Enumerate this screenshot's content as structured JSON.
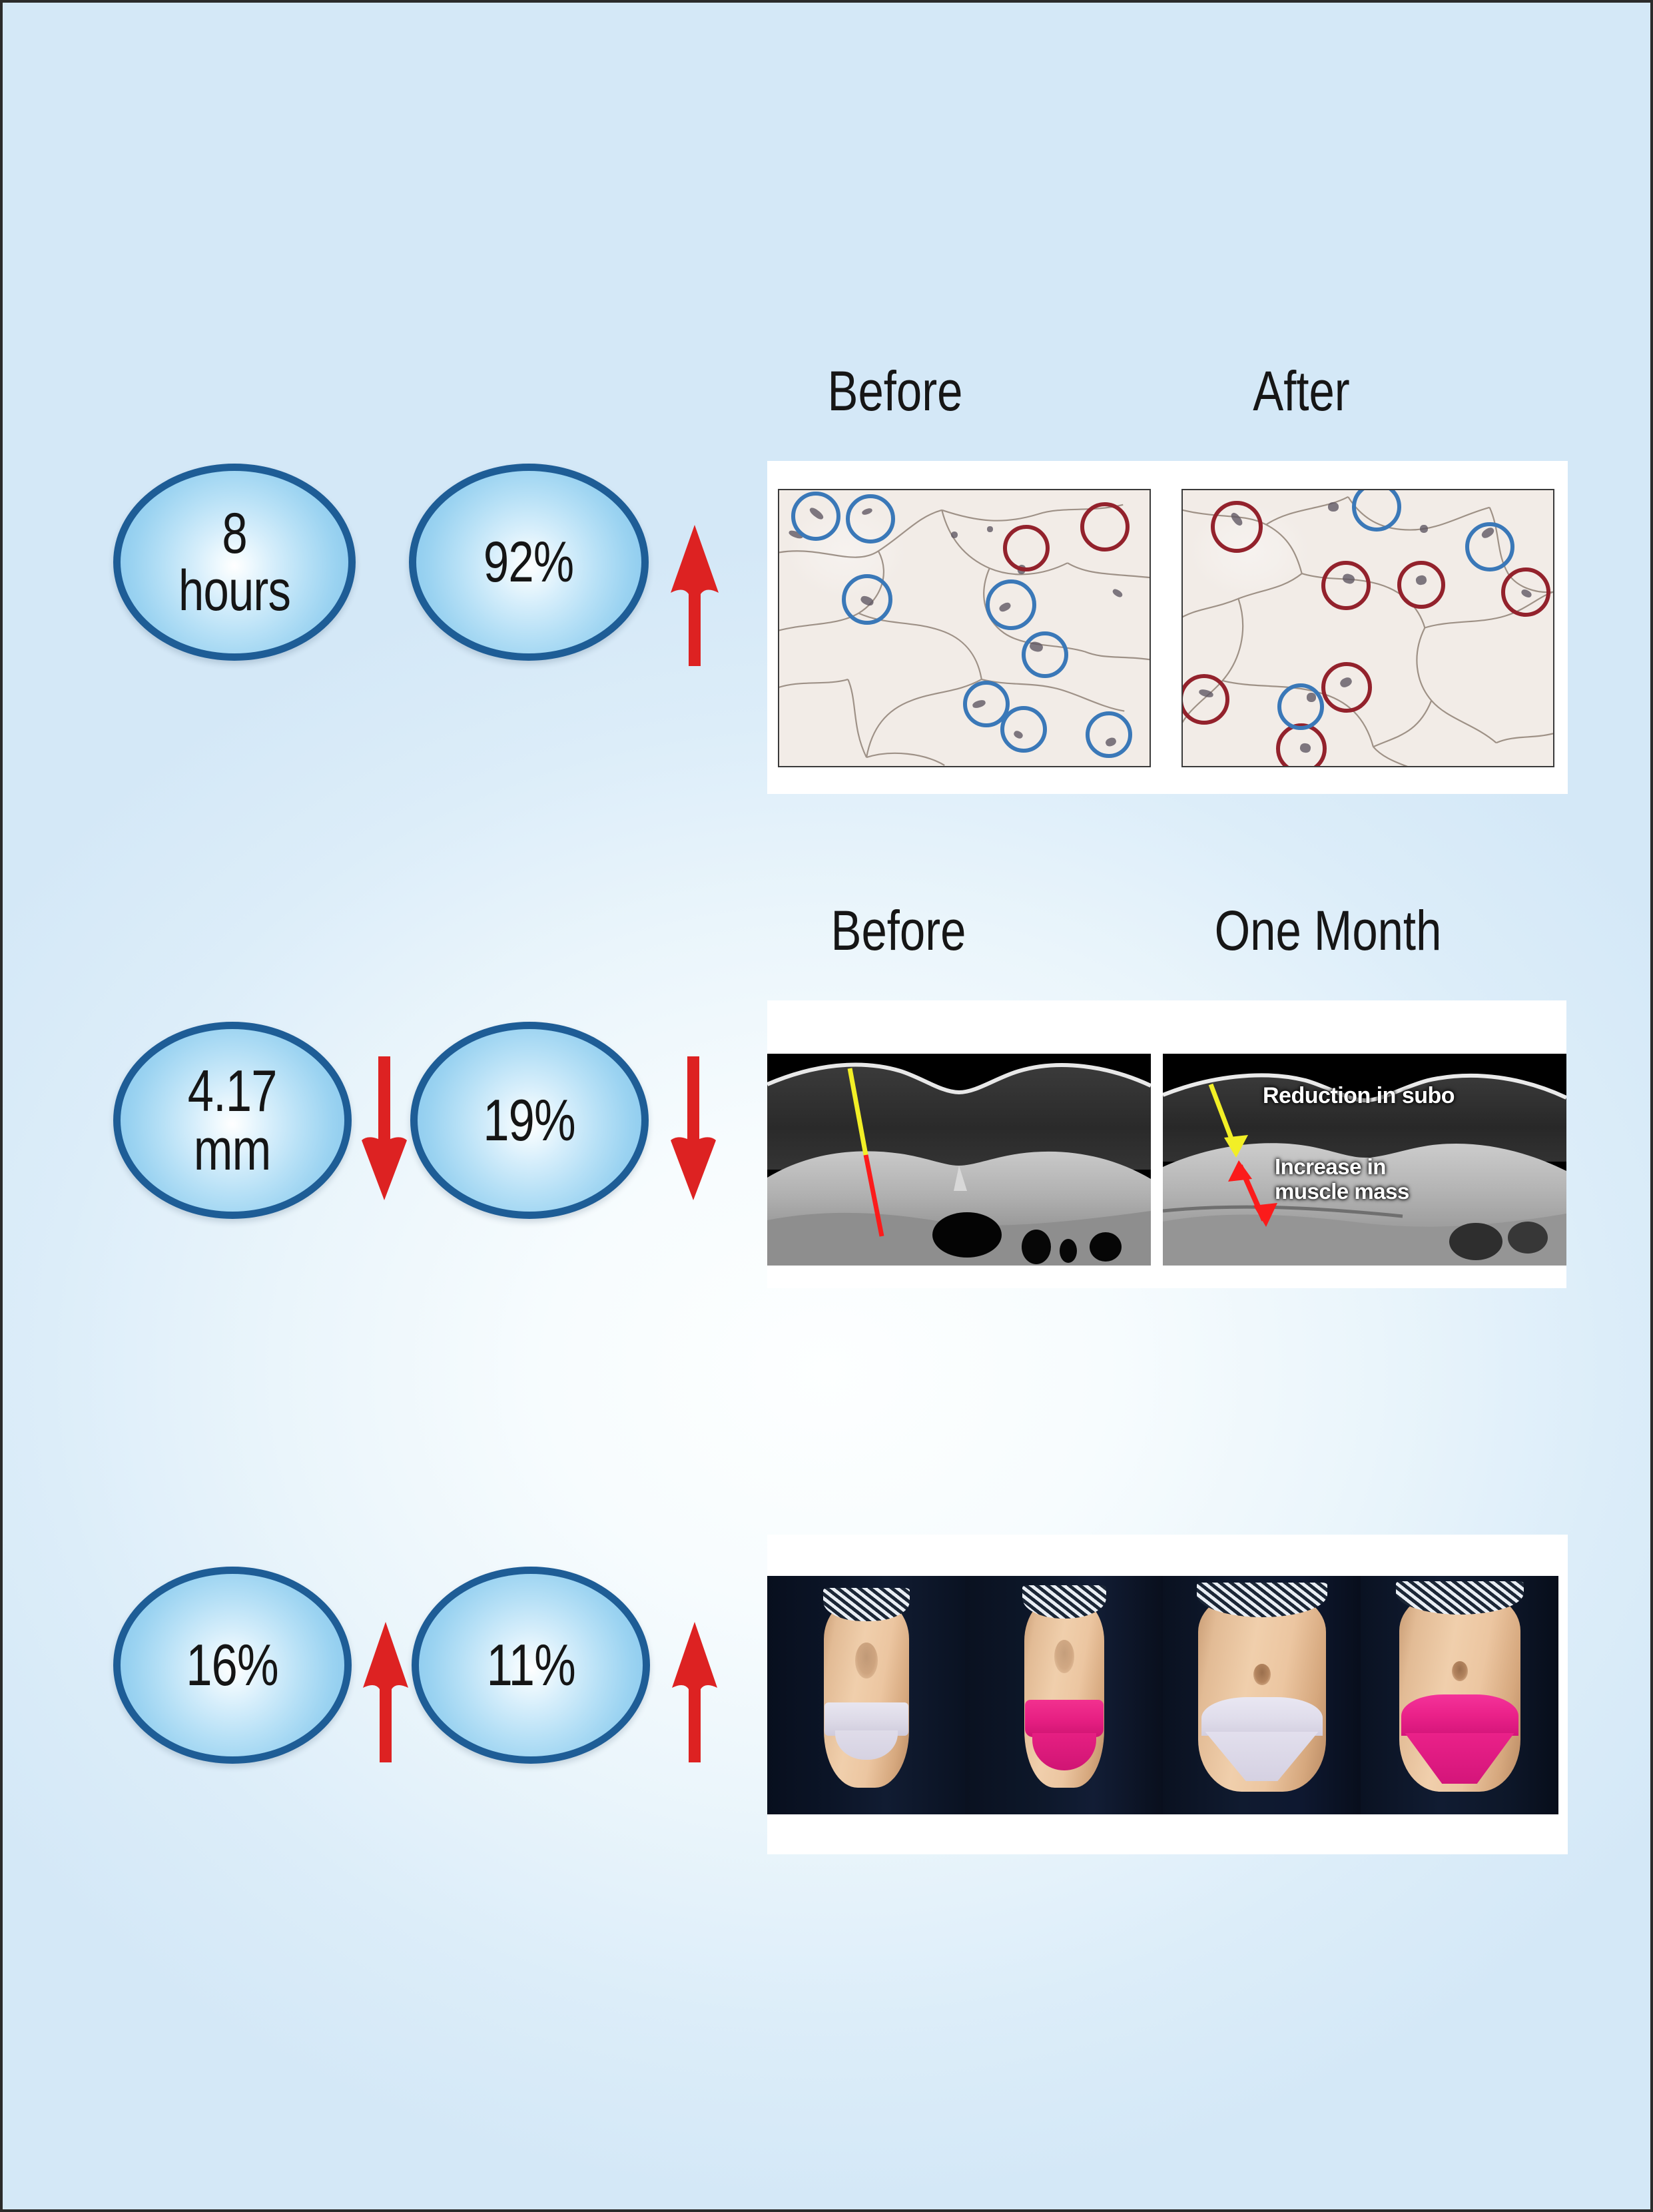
{
  "page": {
    "background_edge_color": "#d6eaf8",
    "background_center_color": "#fdffff",
    "border_color": "#2b2b2b"
  },
  "theme": {
    "circle_border": "#1e5d96",
    "circle_fill_edge": "#84c6ec",
    "circle_fill_center": "#ffffff",
    "arrow_red": "#dd2222",
    "panel_white": "#ffffff",
    "histology_blue_marker": "#3a78b8",
    "histology_red_marker": "#93222c",
    "ct_yellow": "#f2ef26",
    "ct_red": "#fb1b1b",
    "photo_backdrop": "#0b1426"
  },
  "rows": [
    {
      "id": "row-cellular",
      "metrics": [
        {
          "value": "8\nhours",
          "trend": "none"
        },
        {
          "value": "92%",
          "trend": "up"
        }
      ],
      "headers": [
        {
          "label": "Before"
        },
        {
          "label": "After"
        }
      ],
      "figure_type": "histology",
      "figure_caption_left": "Before",
      "figure_caption_right": "After"
    },
    {
      "id": "row-ct",
      "metrics": [
        {
          "value": "4.17\nmm",
          "trend": "down"
        },
        {
          "value": "19%",
          "trend": "down"
        }
      ],
      "headers": [
        {
          "label": "Before"
        },
        {
          "label": "One Month"
        }
      ],
      "figure_type": "ct-scan",
      "annotations": [
        {
          "text": "Reduction in subo",
          "arrow_color": "#f2ef26"
        },
        {
          "text": "Increase in\nmuscle mass",
          "arrow_color": "#fb1b1b"
        }
      ]
    },
    {
      "id": "row-photos",
      "metrics": [
        {
          "value": "16%",
          "trend": "up"
        },
        {
          "value": "11%",
          "trend": "up"
        }
      ],
      "headers": [],
      "figure_type": "clinical-photos",
      "photo_count": 4
    }
  ],
  "icons": {
    "arrow_up": "arrow-up-icon",
    "arrow_down": "arrow-down-icon"
  }
}
